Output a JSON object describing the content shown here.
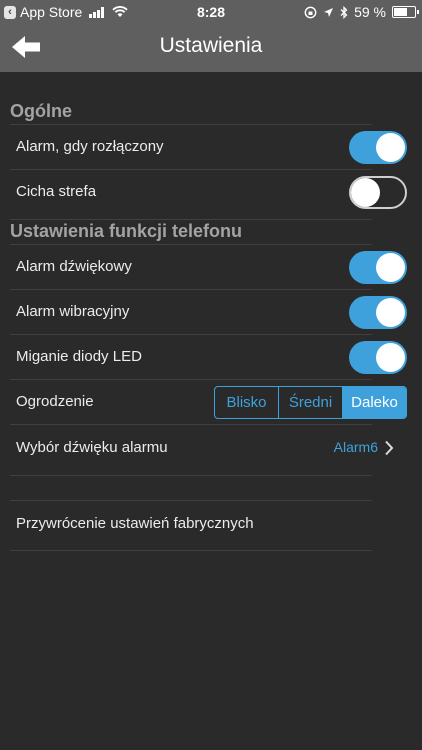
{
  "status_bar": {
    "carrier": "App Store",
    "time": "8:28",
    "battery": "59 %"
  },
  "nav": {
    "title": "Ustawienia"
  },
  "sections": {
    "general": {
      "header": "Ogólne",
      "items": [
        {
          "label": "Alarm, gdy rozłączony",
          "on": true
        },
        {
          "label": "Cicha strefa",
          "on": false
        }
      ]
    },
    "phone": {
      "header": "Ustawienia funkcji telefonu",
      "items": [
        {
          "label": "Alarm dźwiękowy",
          "on": true
        },
        {
          "label": "Alarm wibracyjny",
          "on": true
        },
        {
          "label": "Miganie diody LED",
          "on": true
        }
      ],
      "fence": {
        "label": "Ogrodzenie",
        "options": [
          "Blisko",
          "Średni",
          "Daleko"
        ],
        "selected": "Daleko"
      },
      "sound": {
        "label": "Wybór dźwięku alarmu",
        "value": "Alarm6"
      }
    }
  },
  "reset": {
    "label": "Przywrócenie ustawień fabrycznych"
  },
  "colors": {
    "accent": "#3ea1dc",
    "background": "#2a2a2a",
    "navbar": "#5f5f5f"
  }
}
